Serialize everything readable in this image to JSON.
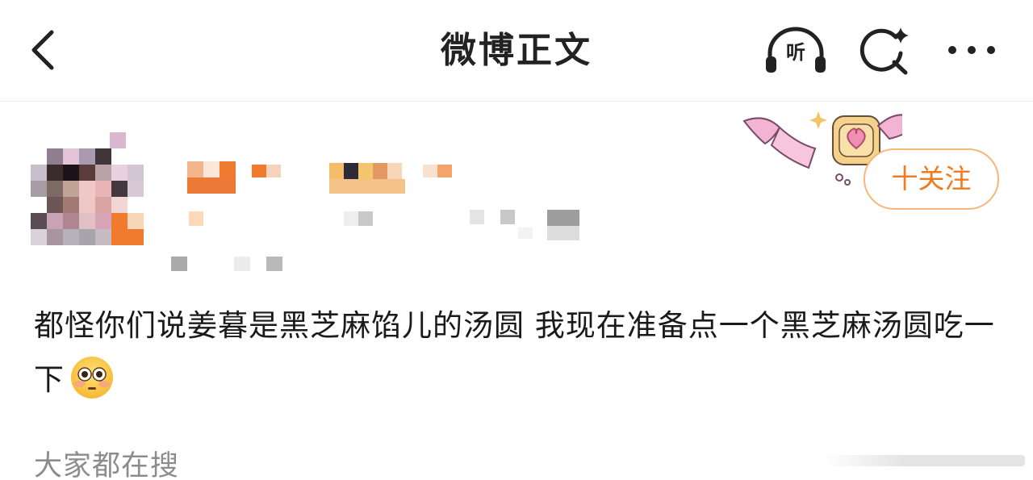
{
  "header": {
    "back_icon": "chevron-left-icon",
    "title": "微博正文",
    "listen_label": "听",
    "listen_icon": "headphones-icon",
    "search_icon": "sparkle-search-icon",
    "more_icon": "ellipsis-icon"
  },
  "author": {
    "avatar_icon": "pixelated-avatar",
    "name": "",
    "meta": "",
    "follow_label": "十关注",
    "follow_color": "#f07a1c",
    "decoration_icon": "pink-ribbon-lock-decoration"
  },
  "post": {
    "text": "都怪你们说姜暮是黑芝麻馅儿的汤圆 我现在准备点一个黑芝麻汤圆吃一下",
    "emoji": "flushed-face-emoji"
  },
  "section": {
    "label": "大家都在搜"
  },
  "colors": {
    "accent": "#f07a1c",
    "text": "#1a1a1a",
    "muted": "#8c8c8c",
    "divider": "#ececec"
  }
}
